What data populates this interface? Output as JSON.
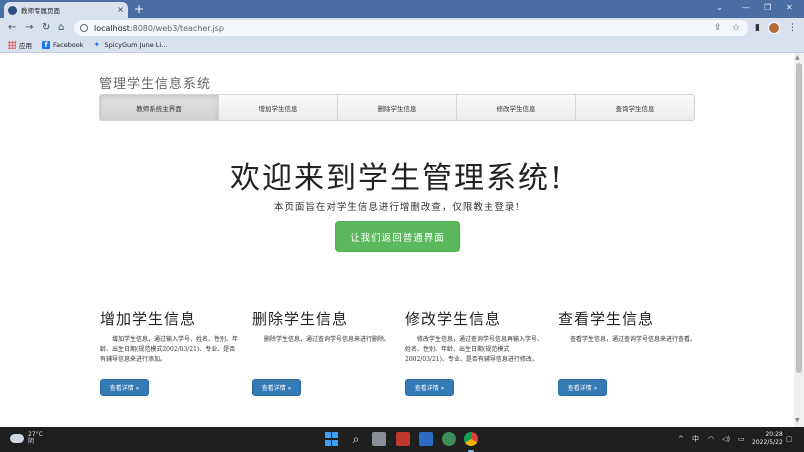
{
  "browser": {
    "tab_title": "教师专属页面",
    "tab_close": "×",
    "new_tab": "+",
    "url_host": "localhost",
    "url_path": ":8080/web3/teacher.jsp",
    "bookmarks": [
      {
        "label": "应用",
        "icon": "apps-grid-icon"
      },
      {
        "label": "Facebook",
        "icon": "facebook-icon"
      },
      {
        "label": "SpicyGum June Li...",
        "icon": "spicygum-icon"
      }
    ]
  },
  "page": {
    "brand": "管理学生信息系统",
    "nav": [
      {
        "label": "教师系统主界面",
        "active": true
      },
      {
        "label": "增加学生信息",
        "active": false
      },
      {
        "label": "删除学生信息",
        "active": false
      },
      {
        "label": "修改学生信息",
        "active": false
      },
      {
        "label": "查询学生信息",
        "active": false
      }
    ],
    "jumbotron": {
      "title": "欢迎来到学生管理系统!",
      "subtitle": "本页面旨在对学生信息进行增删改查，仅限教主登录!",
      "button": "让我们返回普通界面"
    },
    "features": [
      {
        "title": "增加学生信息",
        "desc": "增加学生信息，通过输入学号、姓名、性别、年龄、出生日期(规范模式2002/03/21)、专业、是否有辅导信息来进行添加。",
        "button": "查看详情 »"
      },
      {
        "title": "删除学生信息",
        "desc": "删除学生信息，通过查询学号信息来进行删除。",
        "button": "查看详情 »"
      },
      {
        "title": "修改学生信息",
        "desc": "修改学生信息，通过查询学号信息再输入学号、姓名、性别、年龄、出生日期(规范模式2002/03/21)、专业、是否有辅导信息进行修改。",
        "button": "查看详情 »"
      },
      {
        "title": "查看学生信息",
        "desc": "查看学生信息，通过查询学号信息来进行查看。",
        "button": "查看详情 »"
      }
    ]
  },
  "taskbar": {
    "temperature": "27°C",
    "weather": "阴",
    "ime": "中",
    "time": "20:28",
    "date": "2022/5/22"
  },
  "colors": {
    "tabbar": "#4a6ea3",
    "toolbar": "#d9e1ee",
    "success_button": "#5cb85c",
    "primary_button": "#337ab7",
    "taskbar": "#1f1f1f"
  }
}
